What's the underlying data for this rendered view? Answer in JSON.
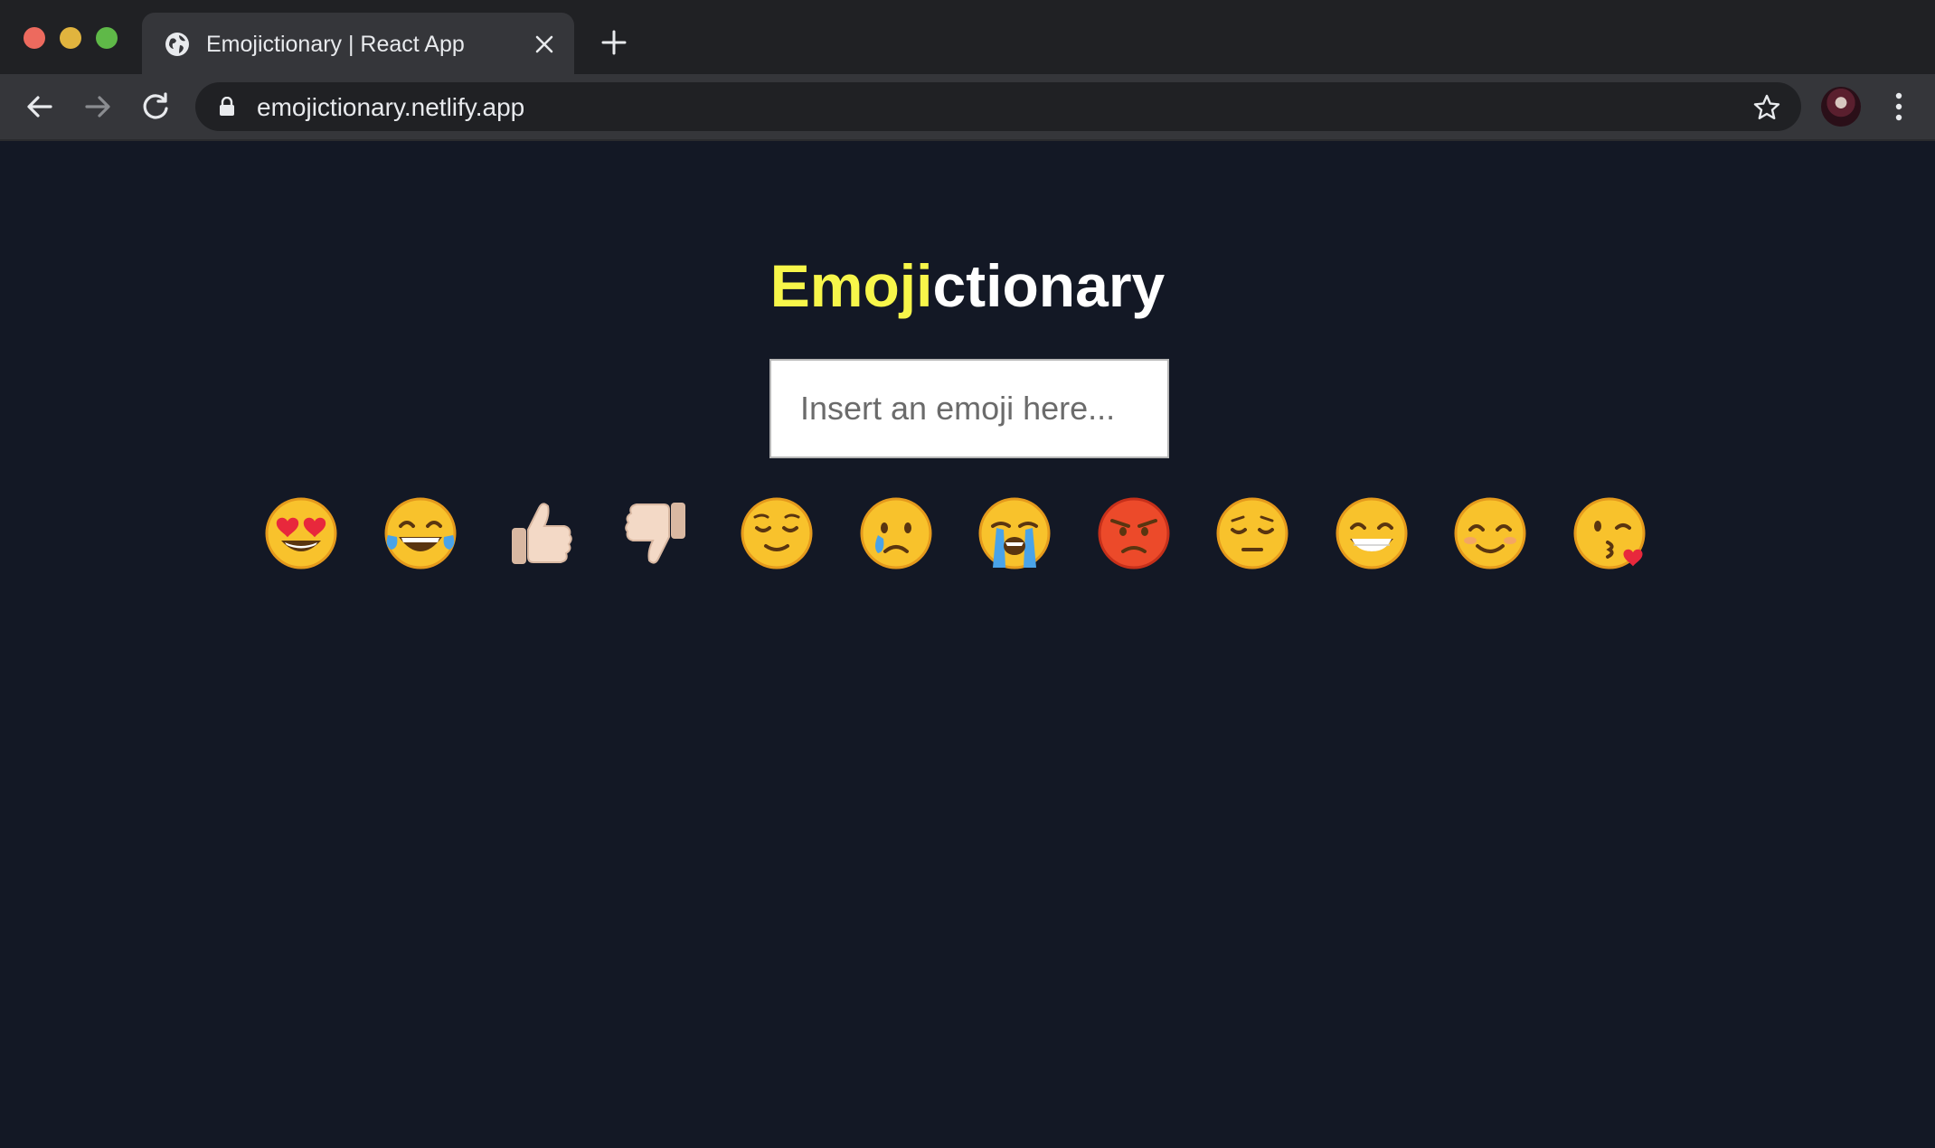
{
  "browser": {
    "tab_title": "Emojictionary | React App",
    "url": "emojictionary.netlify.app"
  },
  "app": {
    "title_accent": "Emoji",
    "title_rest": "ctionary",
    "input_placeholder": "Insert an emoji here..."
  },
  "emojis": [
    {
      "char": "😍",
      "name": "heart-eyes"
    },
    {
      "char": "😂",
      "name": "tears-of-joy"
    },
    {
      "char": "👍🏻",
      "name": "thumbs-up"
    },
    {
      "char": "👎🏻",
      "name": "thumbs-down"
    },
    {
      "char": "😌",
      "name": "relieved"
    },
    {
      "char": "😢",
      "name": "crying"
    },
    {
      "char": "😭",
      "name": "loudly-crying"
    },
    {
      "char": "😡",
      "name": "angry"
    },
    {
      "char": "😔",
      "name": "pensive"
    },
    {
      "char": "😁",
      "name": "beaming"
    },
    {
      "char": "😊",
      "name": "smiling"
    },
    {
      "char": "😘",
      "name": "blowing-kiss"
    }
  ],
  "colors": {
    "page_bg": "#131825",
    "title_accent": "#f7f64a",
    "title_rest": "#ffffff",
    "chrome_dark": "#202124",
    "chrome_toolbar": "#35363a"
  }
}
